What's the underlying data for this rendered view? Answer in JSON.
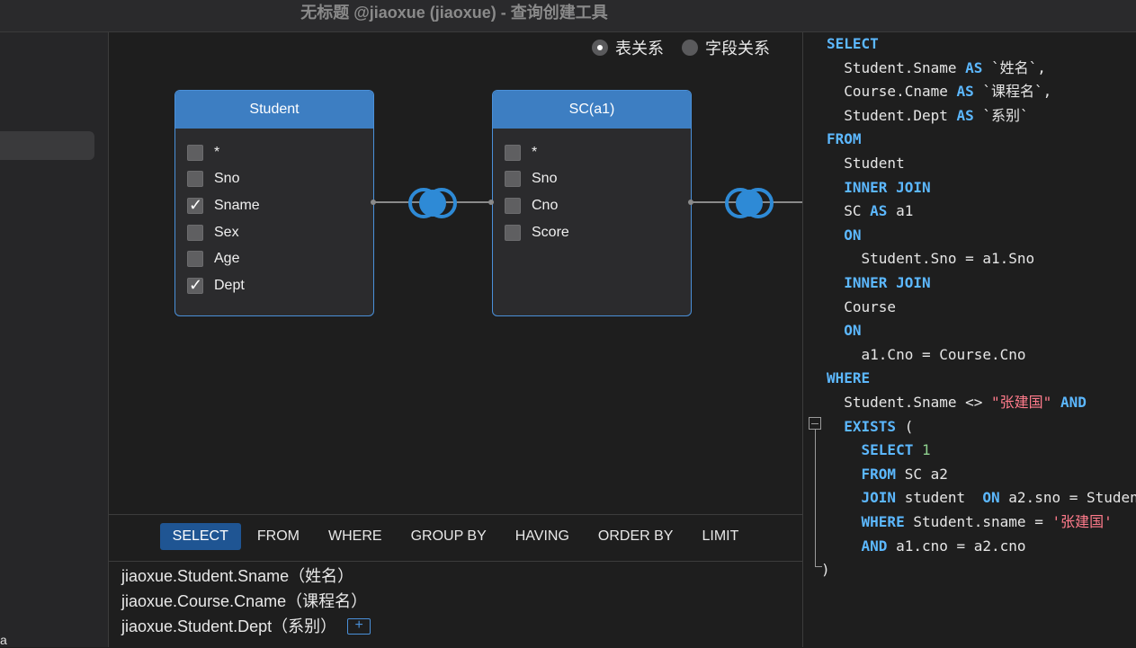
{
  "window": {
    "title": "无标题 @jiaoxue (jiaoxue) - 查询创建工具"
  },
  "sidebar": {
    "bottom_fragment": "a"
  },
  "view_mode": {
    "options": [
      "表关系",
      "字段关系"
    ],
    "selected": "表关系"
  },
  "tables": [
    {
      "name": "Student",
      "fields": [
        {
          "name": "*",
          "checked": false
        },
        {
          "name": "Sno",
          "checked": false
        },
        {
          "name": "Sname",
          "checked": true
        },
        {
          "name": "Sex",
          "checked": false
        },
        {
          "name": "Age",
          "checked": false
        },
        {
          "name": "Dept",
          "checked": true
        }
      ]
    },
    {
      "name": "SC(a1)",
      "fields": [
        {
          "name": "*",
          "checked": false
        },
        {
          "name": "Sno",
          "checked": false
        },
        {
          "name": "Cno",
          "checked": false
        },
        {
          "name": "Score",
          "checked": false
        }
      ]
    }
  ],
  "joins": [
    {
      "type": "inner-join-icon"
    },
    {
      "type": "inner-join-icon"
    }
  ],
  "clause_tabs": {
    "items": [
      "SELECT",
      "FROM",
      "WHERE",
      "GROUP BY",
      "HAVING",
      "ORDER BY",
      "LIMIT"
    ],
    "active": "SELECT"
  },
  "select_columns": [
    "jiaoxue.Student.Sname（姓名）",
    "jiaoxue.Course.Cname（课程名）",
    "jiaoxue.Student.Dept（系别）"
  ],
  "add_button_label": "+",
  "sql_lines": [
    [
      {
        "t": "SELECT",
        "c": "kw"
      }
    ],
    [
      {
        "t": "  Student.Sname "
      },
      {
        "t": "AS",
        "c": "kw"
      },
      {
        "t": " `姓名`,"
      }
    ],
    [
      {
        "t": "  Course.Cname "
      },
      {
        "t": "AS",
        "c": "kw"
      },
      {
        "t": " `课程名`,"
      }
    ],
    [
      {
        "t": "  Student.Dept "
      },
      {
        "t": "AS",
        "c": "kw"
      },
      {
        "t": " `系别`"
      }
    ],
    [
      {
        "t": "FROM",
        "c": "kw"
      }
    ],
    [
      {
        "t": "  Student"
      }
    ],
    [
      {
        "t": "  "
      },
      {
        "t": "INNER JOIN",
        "c": "kw"
      }
    ],
    [
      {
        "t": "  SC "
      },
      {
        "t": "AS",
        "c": "kw"
      },
      {
        "t": " a1"
      }
    ],
    [
      {
        "t": "  "
      },
      {
        "t": "ON",
        "c": "kw"
      }
    ],
    [
      {
        "t": "    Student.Sno = a1.Sno"
      }
    ],
    [
      {
        "t": "  "
      },
      {
        "t": "INNER JOIN",
        "c": "kw"
      }
    ],
    [
      {
        "t": "  Course"
      }
    ],
    [
      {
        "t": "  "
      },
      {
        "t": "ON",
        "c": "kw"
      }
    ],
    [
      {
        "t": "    a1.Cno = Course.Cno"
      }
    ],
    [
      {
        "t": "WHERE",
        "c": "kw"
      }
    ],
    [
      {
        "t": "  Student.Sname <> "
      },
      {
        "t": "\"张建国\"",
        "c": "str"
      },
      {
        "t": " "
      },
      {
        "t": "AND",
        "c": "kw"
      }
    ],
    [
      {
        "t": "  "
      },
      {
        "t": "EXISTS",
        "c": "kw"
      },
      {
        "t": " ("
      }
    ],
    [
      {
        "t": "    "
      },
      {
        "t": "SELECT",
        "c": "kw"
      },
      {
        "t": " "
      },
      {
        "t": "1",
        "c": "num"
      }
    ],
    [
      {
        "t": "    "
      },
      {
        "t": "FROM",
        "c": "kw"
      },
      {
        "t": " SC a2"
      }
    ],
    [
      {
        "t": "    "
      },
      {
        "t": "JOIN",
        "c": "kw"
      },
      {
        "t": " student  "
      },
      {
        "t": "ON",
        "c": "kw"
      },
      {
        "t": " a2.sno = Studen"
      }
    ],
    [
      {
        "t": "    "
      },
      {
        "t": "WHERE",
        "c": "kw"
      },
      {
        "t": " Student.sname = "
      },
      {
        "t": "'张建国'",
        "c": "str"
      }
    ],
    [
      {
        "t": "    "
      },
      {
        "t": "AND",
        "c": "kw"
      },
      {
        "t": " a1.cno = a2.cno"
      }
    ],
    [
      {
        "t": ")"
      }
    ]
  ]
}
